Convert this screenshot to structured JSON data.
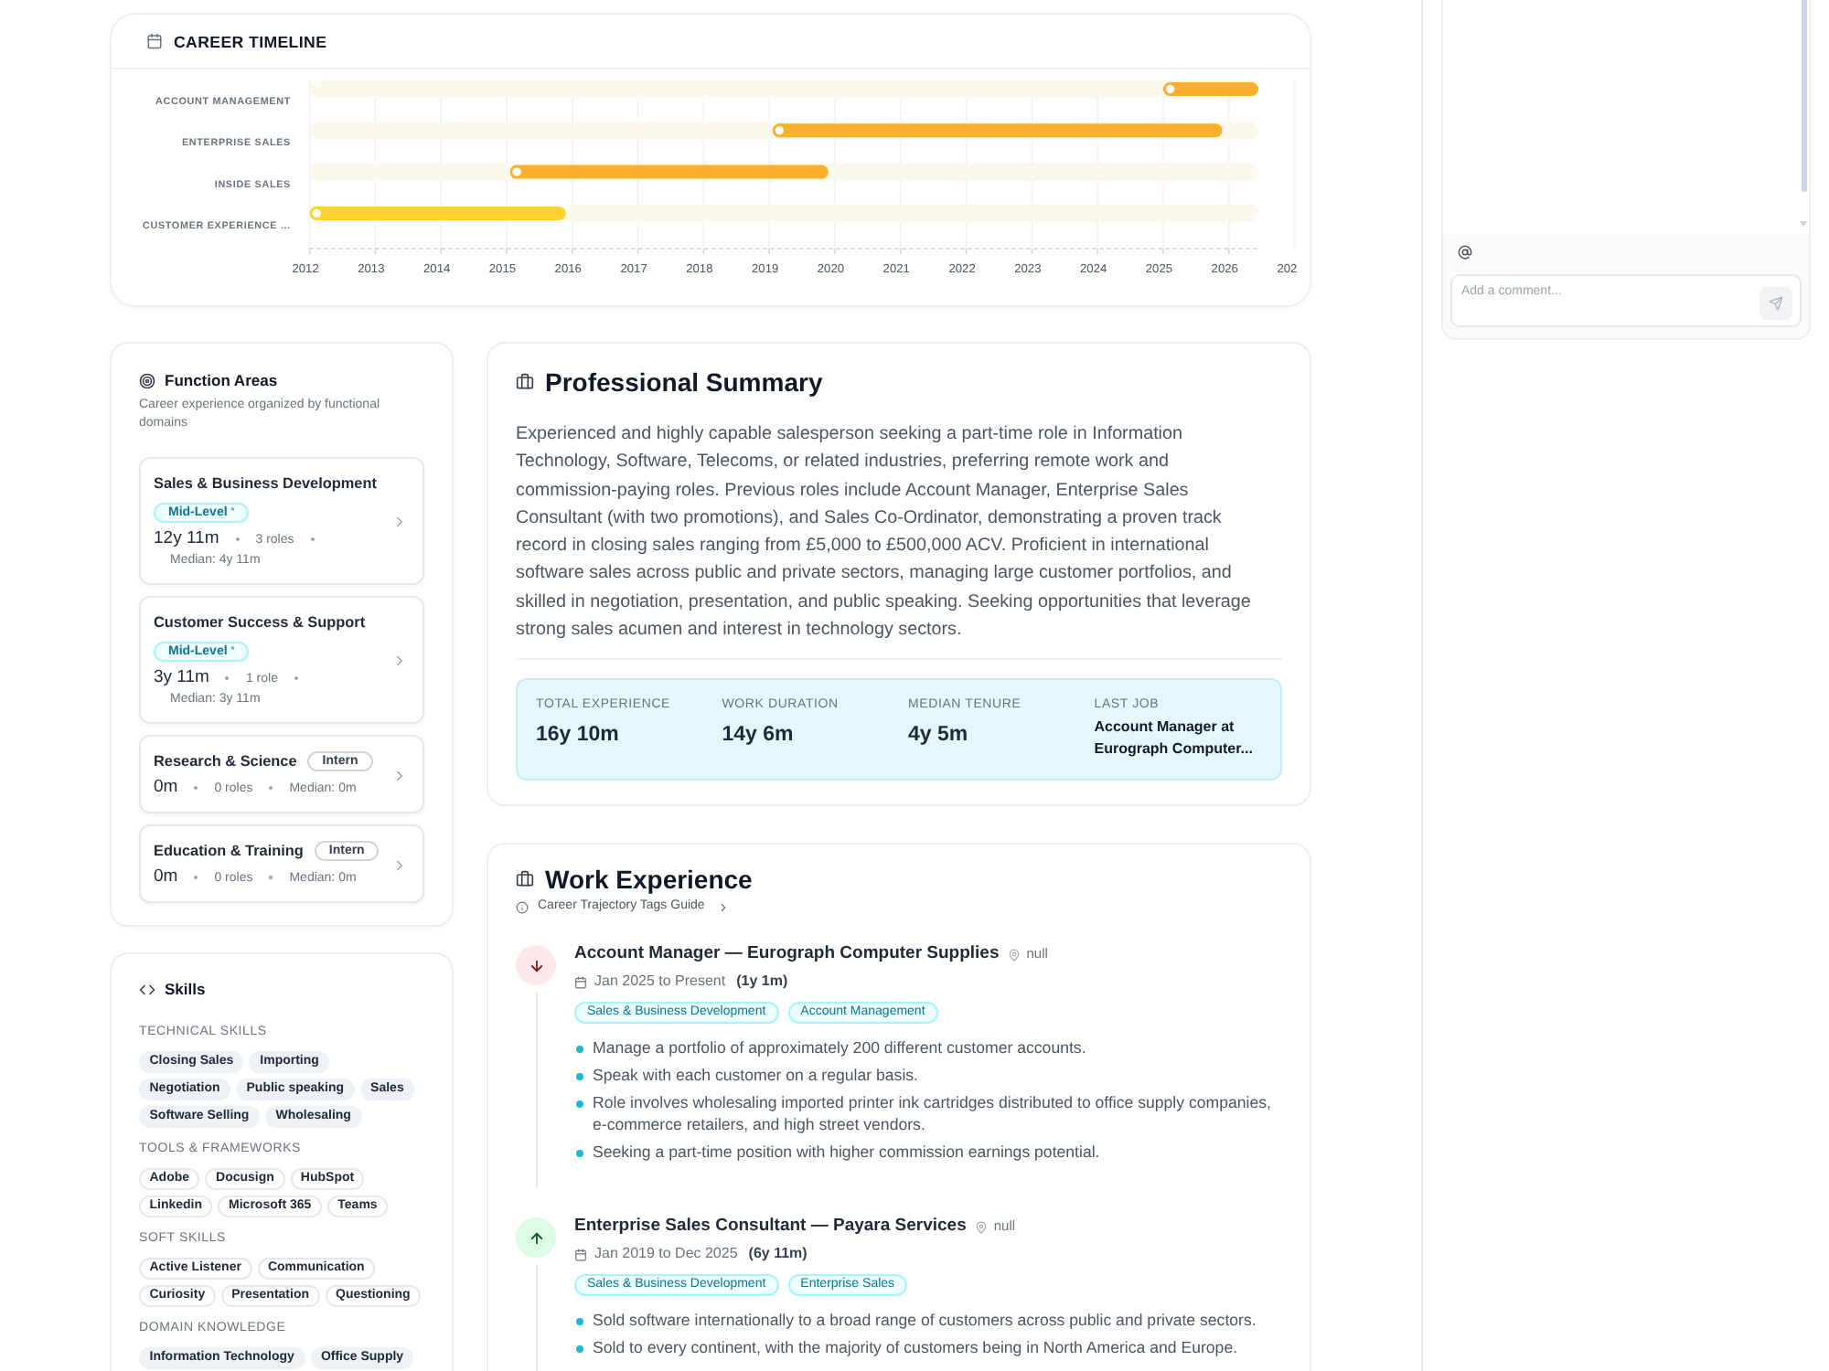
{
  "career_timeline": {
    "title": "CAREER TIMELINE",
    "rows": [
      {
        "label": "ACCOUNT MANAGEMENT",
        "color": "#fbb02c"
      },
      {
        "label": "ENTERPRISE SALES",
        "color": "#fbb02c"
      },
      {
        "label": "INSIDE SALES",
        "color": "#fbb02c"
      },
      {
        "label": "CUSTOMER EXPERIENCE ...",
        "color": "#fdd22a"
      }
    ],
    "year_labels": [
      "2012",
      "2013",
      "2014",
      "2015",
      "2016",
      "2017",
      "2018",
      "2019",
      "2020",
      "2021",
      "2022",
      "2023",
      "2024",
      "2025",
      "2026",
      "202"
    ]
  },
  "function_areas": {
    "title": "Function Areas",
    "description": "Career experience organized by functional domains",
    "items": [
      {
        "name": "Sales & Business Development",
        "seniority": {
          "kind": "mid",
          "label": "Mid-Level",
          "note": "*"
        },
        "duration": "12y 11m",
        "roles": "3 roles",
        "median": "Median: 4y 11m"
      },
      {
        "name": "Customer Success & Support",
        "seniority": {
          "kind": "mid",
          "label": "Mid-Level",
          "note": "*"
        },
        "duration": "3y 11m",
        "roles": "1 role",
        "median": "Median: 3y 11m"
      },
      {
        "name": "Research & Science",
        "seniority": {
          "kind": "intern",
          "label": "Intern"
        },
        "duration": "0m",
        "roles": "0 roles",
        "median": "Median: 0m"
      },
      {
        "name": "Education & Training",
        "seniority": {
          "kind": "intern",
          "label": "Intern"
        },
        "duration": "0m",
        "roles": "0 roles",
        "median": "Median: 0m"
      }
    ]
  },
  "skills": {
    "title": "Skills",
    "groups": [
      {
        "heading": "TECHNICAL SKILLS",
        "kind": "filled",
        "items": [
          "Closing Sales",
          "Importing",
          "Negotiation",
          "Public speaking",
          "Sales",
          "Software Selling",
          "Wholesaling"
        ]
      },
      {
        "heading": "TOOLS & FRAMEWORKS",
        "kind": "outlined",
        "items": [
          "Adobe",
          "Docusign",
          "HubSpot",
          "Linkedin",
          "Microsoft 365",
          "Teams"
        ]
      },
      {
        "heading": "SOFT SKILLS",
        "kind": "outlined",
        "items": [
          "Active Listener",
          "Communication",
          "Curiosity",
          "Presentation",
          "Questioning"
        ]
      },
      {
        "heading": "DOMAIN KNOWLEDGE",
        "kind": "filled",
        "items": [
          "Information Technology",
          "Office Supply"
        ]
      }
    ]
  },
  "professional_summary": {
    "title": "Professional Summary",
    "text": "Experienced and highly capable salesperson seeking a part-time role in Information Technology, Software, Telecoms, or related industries, preferring remote work and commission-paying roles. Previous roles include Account Manager, Enterprise Sales Consultant (with two promotions), and Sales Co-Ordinator, demonstrating a proven track record in closing sales ranging from £5,000 to £500,000 ACV. Proficient in international software sales across public and private sectors, managing large customer portfolios, and skilled in negotiation, presentation, and public speaking. Seeking opportunities that leverage strong sales acumen and interest in technology sectors.",
    "stats": [
      {
        "kind": "duration",
        "label": "TOTAL EXPERIENCE",
        "value": "16y 10m"
      },
      {
        "kind": "duration",
        "label": "WORK DURATION",
        "value": "14y 6m"
      },
      {
        "kind": "duration",
        "label": "MEDIAN TENURE",
        "value": "4y 5m"
      },
      {
        "kind": "job",
        "label": "LAST JOB",
        "value": "Account Manager at Eurograph Computer..."
      }
    ]
  },
  "work_experience": {
    "title": "Work Experience",
    "guide_link": "Career Trajectory Tags Guide",
    "entries": [
      {
        "kind": "down",
        "title": "Account Manager — Eurograph Computer Supplies",
        "location": "null",
        "dates": "Jan 2025 to Present",
        "duration": "(1y 1m)",
        "tags": [
          "Sales & Business Development",
          "Account Management"
        ],
        "bullets": [
          "Manage a portfolio of approximately 200 different customer accounts.",
          "Speak with each customer on a regular basis.",
          "Role involves wholesaling imported printer ink cartridges distributed to office supply companies, e-commerce retailers, and high street vendors.",
          "Seeking a part-time position with higher commission earnings potential."
        ]
      },
      {
        "kind": "up",
        "title": "Enterprise Sales Consultant — Payara Services",
        "location": "null",
        "dates": "Jan 2019 to Dec 2025",
        "duration": "(6y 11m)",
        "tags": [
          "Sales & Business Development",
          "Enterprise Sales"
        ],
        "bullets": [
          "Sold software internationally to a broad range of customers across public and private sectors.",
          "Sold to every continent, with the majority of customers being in North America and Europe."
        ]
      }
    ]
  },
  "comments": {
    "placeholder": "Add a comment..."
  }
}
